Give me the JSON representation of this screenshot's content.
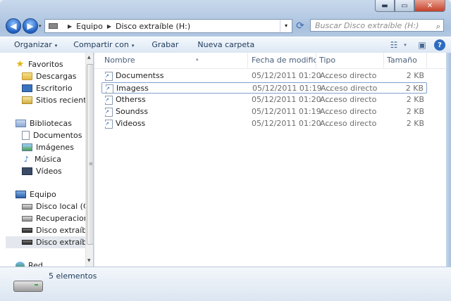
{
  "window": {
    "caption_buttons": {
      "minimize": "▬",
      "maximize": "▭",
      "close": "✕"
    }
  },
  "address": {
    "back_glyph": "◀",
    "forward_glyph": "▶",
    "recent_glyph": "▾",
    "crumbs": [
      "Equipo",
      "Disco extraíble (H:)"
    ],
    "separator": "▶",
    "dropdown_glyph": "▾",
    "refresh_glyph": "⟳",
    "search_placeholder": "Buscar Disco extraíble (H:)",
    "search_glyph": "⌕"
  },
  "toolbar": {
    "organize": "Organizar",
    "share": "Compartir con",
    "burn": "Grabar",
    "new_folder": "Nueva carpeta",
    "dropdown_glyph": "▾",
    "views_glyph": "☷",
    "preview_glyph": "▣",
    "help_glyph": "?"
  },
  "nav": {
    "favorites_header": "Favoritos",
    "favorites": [
      "Descargas",
      "Escritorio",
      "Sitios recientes"
    ],
    "libraries_header": "Bibliotecas",
    "libraries": [
      "Documentos",
      "Imágenes",
      "Música",
      "Vídeos"
    ],
    "computer_header": "Equipo",
    "drives": [
      "Disco local (C:)",
      "Recuperacion (D:",
      "Disco extraíble (G",
      "Disco extraíble (H"
    ],
    "network_header": "Red",
    "selected_drive_index": 3,
    "scroll_up": "▲",
    "scroll_down": "▼",
    "grip": "≡"
  },
  "columns": {
    "name": "Nombre",
    "date": "Fecha de modifica...",
    "type": "Tipo",
    "size": "Tamaño",
    "sort_glyph": "▴"
  },
  "files": [
    {
      "name": "Documentss",
      "date": "05/12/2011 01:20 ...",
      "type": "Acceso directo",
      "size": "2 KB"
    },
    {
      "name": "Imagess",
      "date": "05/12/2011 01:19 ...",
      "type": "Acceso directo",
      "size": "2 KB"
    },
    {
      "name": "Otherss",
      "date": "05/12/2011 01:20 ...",
      "type": "Acceso directo",
      "size": "2 KB"
    },
    {
      "name": "Soundss",
      "date": "05/12/2011 01:19 ...",
      "type": "Acceso directo",
      "size": "2 KB"
    },
    {
      "name": "Videoss",
      "date": "05/12/2011 01:20 ...",
      "type": "Acceso directo",
      "size": "2 KB"
    }
  ],
  "selected_file_index": 1,
  "status": {
    "item_count": "5 elementos"
  }
}
